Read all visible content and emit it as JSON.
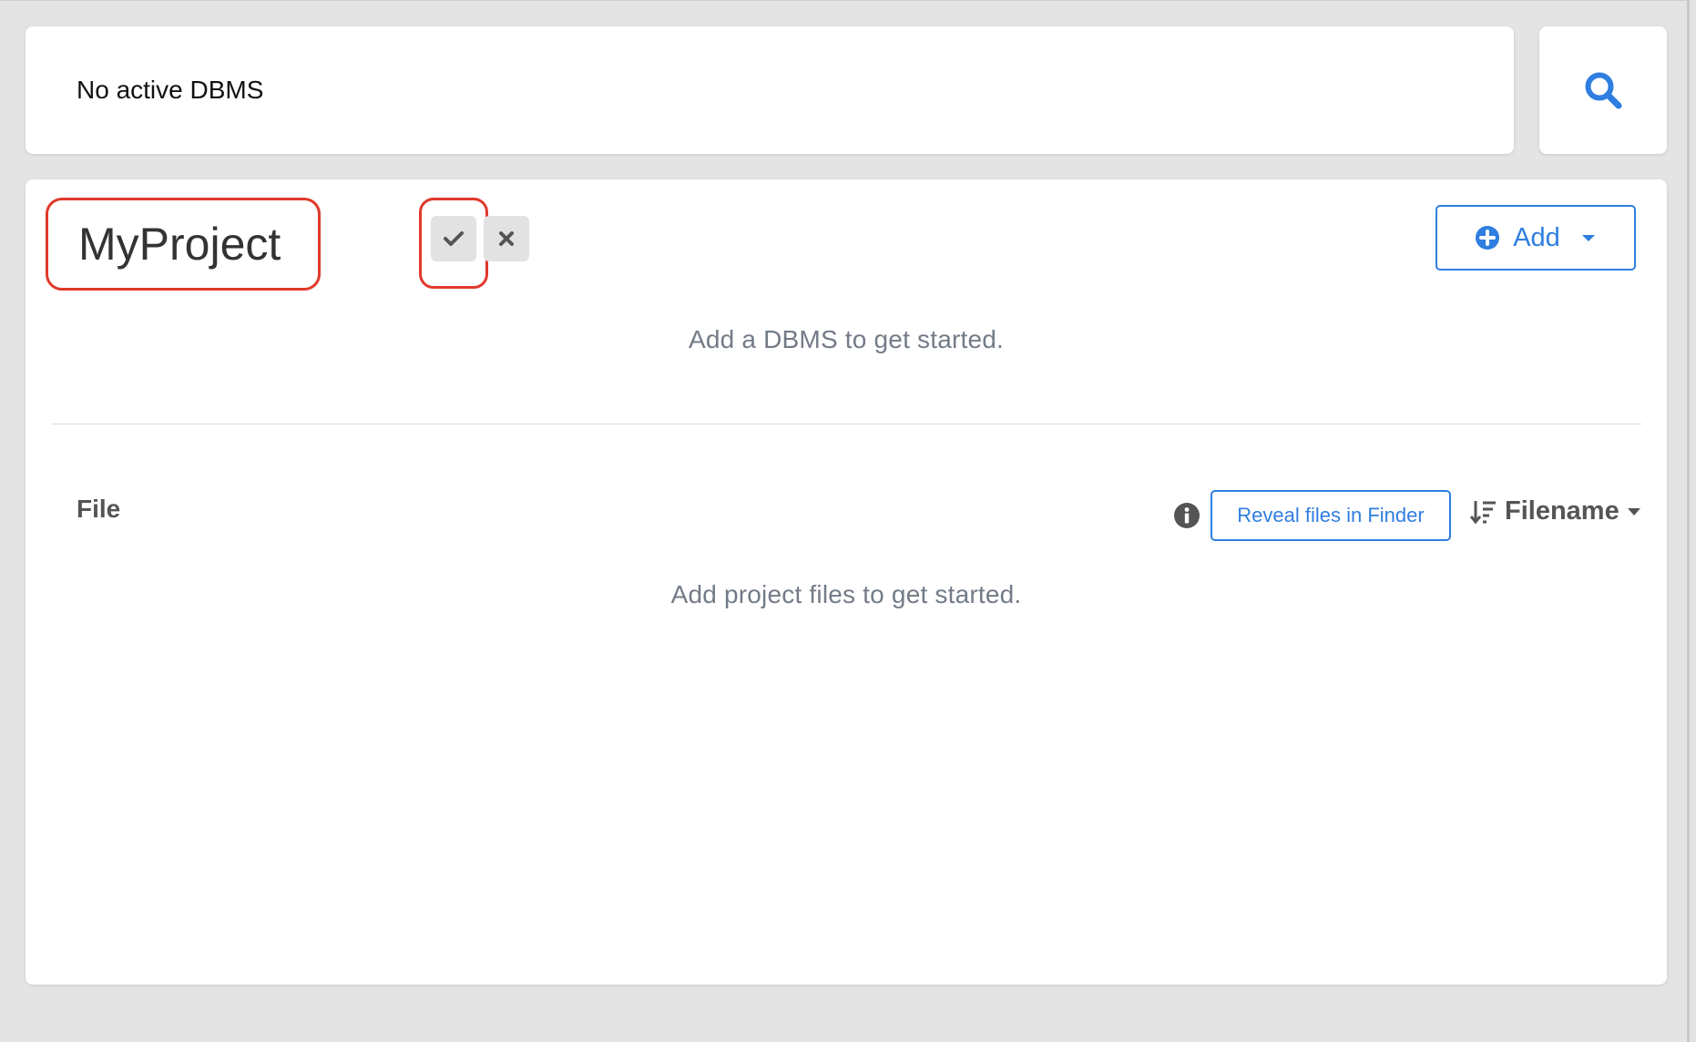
{
  "topbar": {
    "status_text": "No active DBMS"
  },
  "search": {
    "icon": "search-icon"
  },
  "project": {
    "name": "MyProject",
    "confirm_icon": "check-icon",
    "cancel_icon": "close-icon",
    "add_label": "Add",
    "dbms_empty_text": "Add a DBMS to get started."
  },
  "files": {
    "header": "File",
    "reveal_label": "Reveal files in Finder",
    "sort_label": "Filename",
    "empty_text": "Add project files to get started."
  },
  "colors": {
    "accent": "#2f7ee0",
    "highlight": "#e0392b",
    "muted_text": "#737b87"
  }
}
